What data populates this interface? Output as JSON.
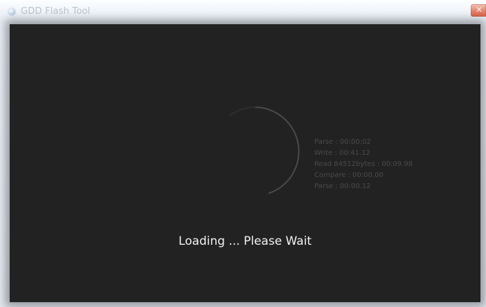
{
  "window": {
    "title": "GDD Flash Tool",
    "close_glyph": "✕"
  },
  "icons": {
    "app": "app-icon",
    "close": "close-icon",
    "spinner": "loading-spinner-icon"
  },
  "progress": {
    "stats": [
      "Parse : 00:00:02",
      "Write : 00:41.12",
      "Read 84512bytes : 00:09.98",
      "Compare : 00:00.00",
      "Parse : 00:00.12"
    ],
    "message": "Loading ... Please Wait"
  },
  "colors": {
    "background": "#222222",
    "spinner_arc": "#4a4a4a",
    "stats_text": "#4a4a4a",
    "message_text": "#f2f2f2",
    "close_button": "#d9644a"
  }
}
